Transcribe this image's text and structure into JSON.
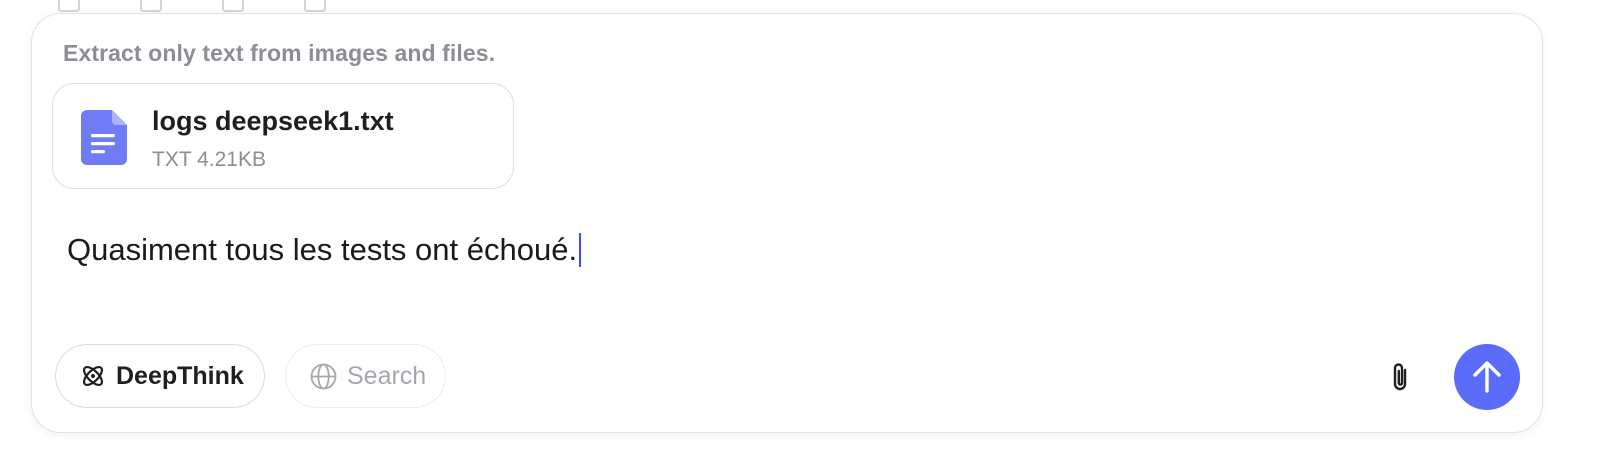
{
  "composer": {
    "hint": "Extract only text from images and files.",
    "attachment": {
      "name": "logs deepseek1.txt",
      "meta": "TXT 4.21KB",
      "icon": "document-icon"
    },
    "message": "Quasiment tous les tests ont échoué."
  },
  "toolbar": {
    "deepthink_label": "DeepThink",
    "deepthink_icon": "atom-icon",
    "search_label": "Search",
    "search_icon": "globe-icon",
    "attach_icon": "paperclip-icon",
    "send_icon": "arrow-up-icon"
  },
  "colors": {
    "accent": "#5b6cf9",
    "file_icon": "#6f7cf5",
    "muted_text": "#8d8d95",
    "caret": "#3b4cff"
  }
}
